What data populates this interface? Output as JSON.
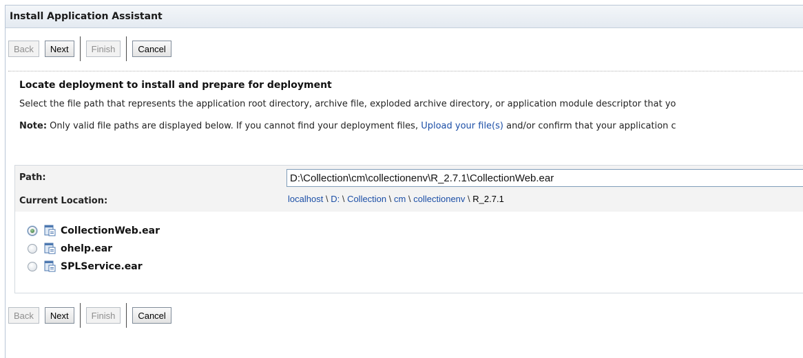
{
  "title": "Install Application Assistant",
  "buttons": {
    "back": "Back",
    "next": "Next",
    "finish": "Finish",
    "cancel": "Cancel"
  },
  "heading": "Locate deployment to install and prepare for deployment",
  "description": "Select the file path that represents the application root directory, archive file, exploded archive directory, or application module descriptor that yo",
  "note": {
    "label": "Note:",
    "text_before": " Only valid file paths are displayed below. If you cannot find your deployment files, ",
    "link": "Upload your file(s)",
    "text_after": " and/or confirm that your application c"
  },
  "path": {
    "label": "Path:",
    "value": "D:\\Collection\\cm\\collectionenv\\R_2.7.1\\CollectionWeb.ear"
  },
  "location": {
    "label": "Current Location:",
    "crumbs": [
      "localhost",
      "D:",
      "Collection",
      "cm",
      "collectionenv"
    ],
    "separator": "\\",
    "current": "R_2.7.1"
  },
  "files": [
    {
      "name": "CollectionWeb.ear",
      "selected": true
    },
    {
      "name": "ohelp.ear",
      "selected": false
    },
    {
      "name": "SPLService.ear",
      "selected": false
    }
  ],
  "colors": {
    "link": "#1b4ea6",
    "panel_bg": "#f3f3f3"
  }
}
